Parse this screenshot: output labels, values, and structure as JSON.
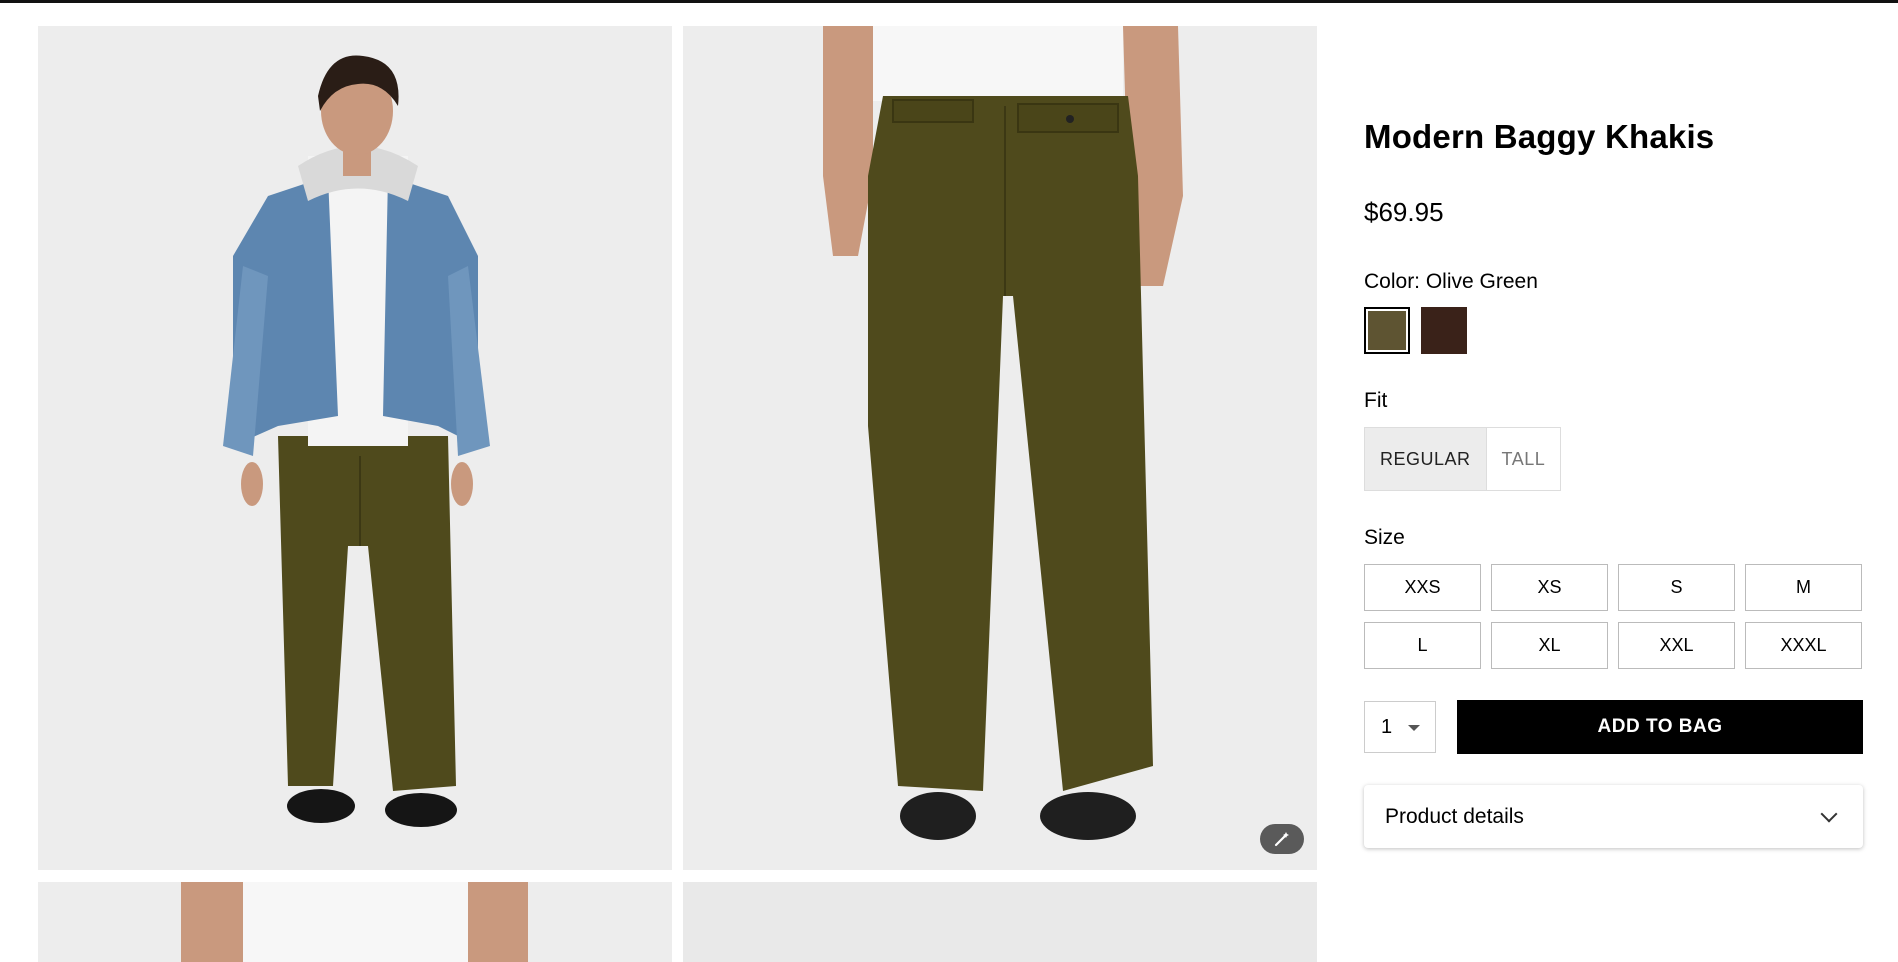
{
  "product": {
    "title": "Modern Baggy Khakis",
    "price": "$69.95",
    "color_label": "Color: Olive Green",
    "colors": [
      {
        "name": "Olive Green",
        "hex": "#5e5432",
        "selected": true
      },
      {
        "name": "Dark Brown",
        "hex": "#3a2219",
        "selected": false
      }
    ],
    "fit_label": "Fit",
    "fits": [
      {
        "label": "REGULAR",
        "selected": true
      },
      {
        "label": "TALL",
        "selected": false
      }
    ],
    "size_label": "Size",
    "sizes": [
      "XXS",
      "XS",
      "S",
      "M",
      "L",
      "XL",
      "XXL",
      "XXXL"
    ],
    "quantity": "1",
    "add_to_bag": "ADD TO BAG",
    "details_label": "Product details"
  },
  "gallery": {
    "images": [
      {
        "name": "front-view-photo"
      },
      {
        "name": "back-view-photo"
      },
      {
        "name": "detail-photo-3"
      },
      {
        "name": "detail-photo-4"
      }
    ],
    "zoom_icon": "magic-wand-icon"
  },
  "colors": {
    "accent": "#000000",
    "khaki": "#4f4a1c",
    "denim": "#5d86b0",
    "photo_bg": "#ececec"
  }
}
